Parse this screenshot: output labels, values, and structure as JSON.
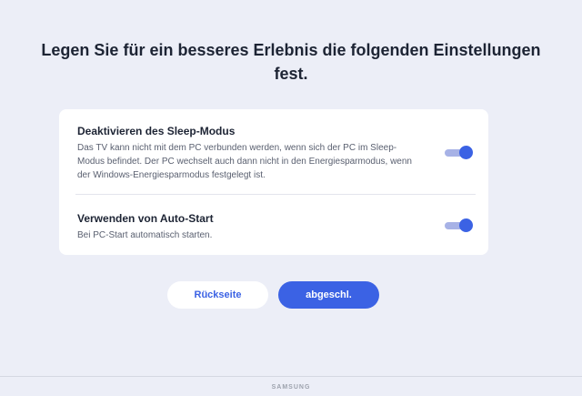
{
  "page": {
    "title": "Legen Sie für ein besseres Erlebnis die folgenden Einstellungen fest."
  },
  "settings": [
    {
      "title": "Deaktivieren des Sleep-Modus",
      "description": "Das TV kann nicht mit dem PC verbunden werden, wenn sich der PC im Sleep-Modus befindet. Der PC wechselt auch dann nicht in den Energiesparmodus, wenn der Windows-Energiesparmodus festgelegt ist.",
      "enabled": true
    },
    {
      "title": "Verwenden von Auto-Start",
      "description": "Bei PC-Start automatisch starten.",
      "enabled": true
    }
  ],
  "buttons": {
    "back_label": "Rückseite",
    "done_label": "abgeschl."
  },
  "footer": {
    "brand": "SAMSUNG"
  },
  "colors": {
    "background": "#eceef7",
    "accent": "#3b62e4",
    "toggle_track": "#a7b2e6",
    "card": "#ffffff"
  }
}
